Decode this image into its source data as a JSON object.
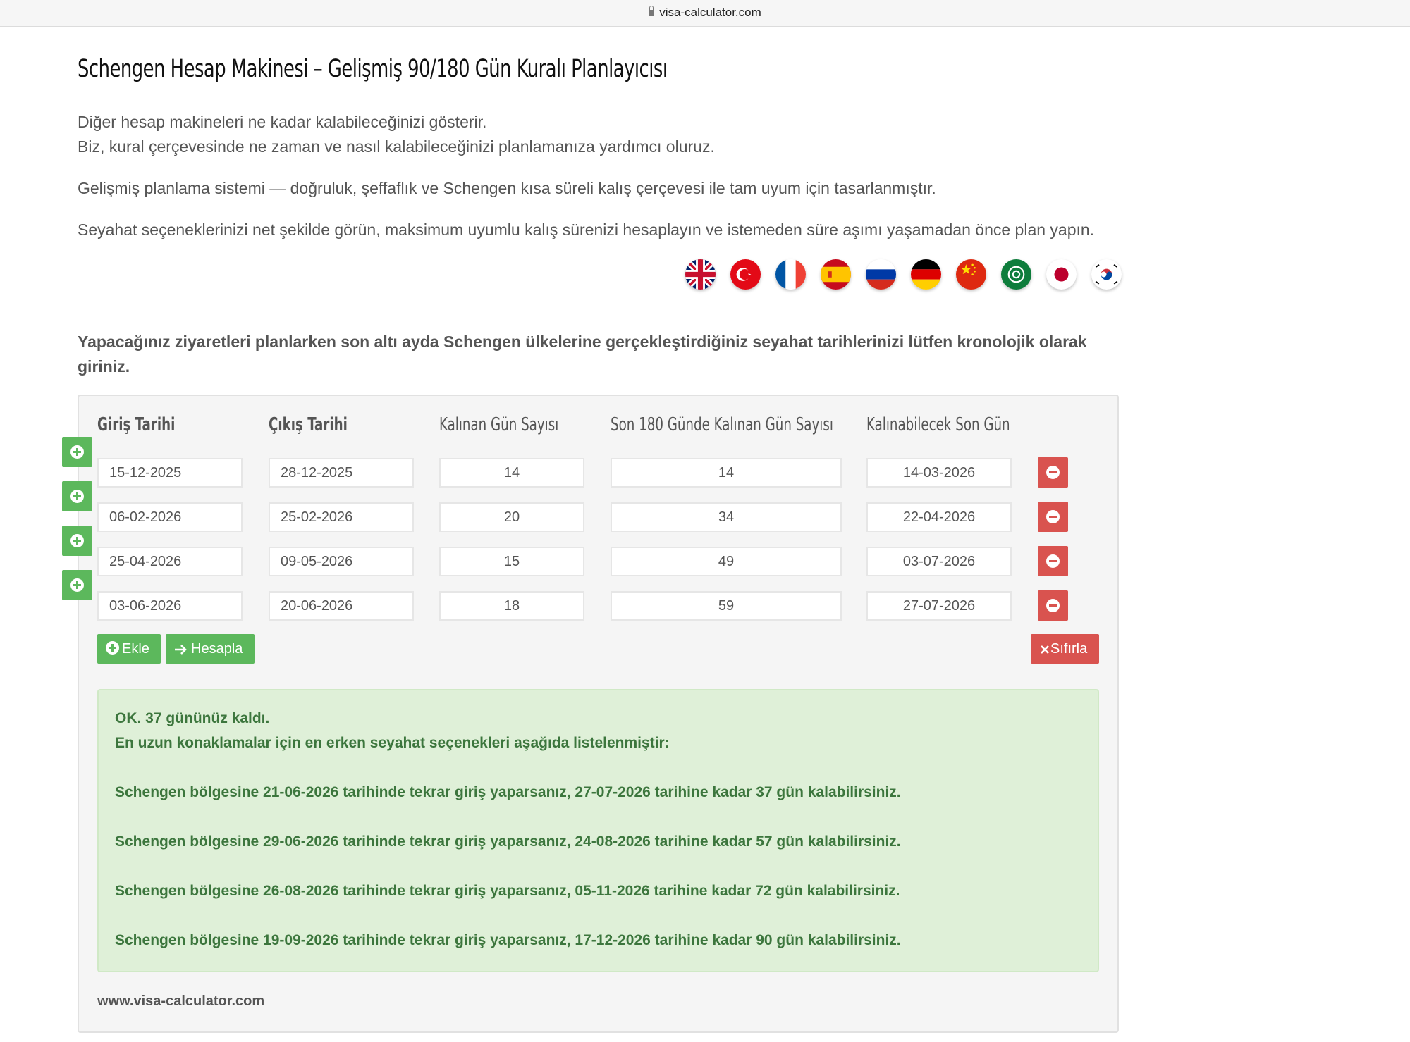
{
  "browser": {
    "url": "visa-calculator.com"
  },
  "page": {
    "title": "Schengen Hesap Makinesi – Gelişmiş 90/180 Gün Kuralı Planlayıcısı",
    "intro_line1": "Diğer hesap makineleri ne kadar kalabileceğinizi gösterir.",
    "intro_line2": "Biz, kural çerçevesinde ne zaman ve nasıl kalabileceğinizi planlamanıza yardımcı oluruz.",
    "intro_line3": "Gelişmiş planlama sistemi — doğruluk, şeffaflık ve Schengen kısa süreli kalış çerçevesi ile tam uyum için tasarlanmıştır.",
    "intro_line4": "Seyahat seçeneklerinizi net şekilde görün, maksimum uyumlu kalış sürenizi hesaplayın ve istemeden süre aşımı yaşamadan önce plan yapın.",
    "instructions": "Yapacağınız ziyaretleri planlarken son altı ayda Schengen ülkelerine gerçekleştirdiğiniz seyahat tarihlerinizi lütfen kronolojik olarak giriniz."
  },
  "flags": [
    "uk-flag-icon",
    "turkey-flag-icon",
    "france-flag-icon",
    "spain-flag-icon",
    "russia-flag-icon",
    "germany-flag-icon",
    "china-flag-icon",
    "arab-league-flag-icon",
    "japan-flag-icon",
    "south-korea-flag-icon"
  ],
  "table": {
    "headers": {
      "entry": "Giriş Tarihi",
      "exit": "Çıkış Tarihi",
      "days": "Kalınan Gün Sayısı",
      "days180": "Son 180 Günde Kalınan Gün Sayısı",
      "lastday": "Kalınabilecek Son Gün"
    },
    "rows": [
      {
        "entry": "15-12-2025",
        "exit": "28-12-2025",
        "days": "14",
        "days180": "14",
        "lastday": "14-03-2026"
      },
      {
        "entry": "06-02-2026",
        "exit": "25-02-2026",
        "days": "20",
        "days180": "34",
        "lastday": "22-04-2026"
      },
      {
        "entry": "25-04-2026",
        "exit": "09-05-2026",
        "days": "15",
        "days180": "49",
        "lastday": "03-07-2026"
      },
      {
        "entry": "03-06-2026",
        "exit": "20-06-2026",
        "days": "18",
        "days180": "59",
        "lastday": "27-07-2026"
      }
    ]
  },
  "buttons": {
    "add": "Ekle",
    "calculate": "Hesapla",
    "reset": "Sıfırla"
  },
  "result": {
    "status": "OK.  37 gününüz kaldı.",
    "subtitle": "En uzun konaklamalar için en erken seyahat seçenekleri aşağıda listelenmiştir:",
    "options": [
      "Schengen bölgesine 21-06-2026 tarihinde tekrar giriş yaparsanız, 27-07-2026 tarihine kadar 37 gün kalabilirsiniz.",
      "Schengen bölgesine 29-06-2026 tarihinde tekrar giriş yaparsanız, 24-08-2026 tarihine kadar 57 gün kalabilirsiniz.",
      "Schengen bölgesine 26-08-2026 tarihinde tekrar giriş yaparsanız, 05-11-2026 tarihine kadar 72 gün kalabilirsiniz.",
      "Schengen bölgesine 19-09-2026 tarihinde tekrar giriş yaparsanız, 17-12-2026 tarihine kadar 90 gün kalabilirsiniz."
    ]
  },
  "footer": "www.visa-calculator.com",
  "colors": {
    "green": "#5cb85c",
    "red": "#d9534f",
    "success_bg": "#dff0d8",
    "success_text": "#3c763d"
  }
}
